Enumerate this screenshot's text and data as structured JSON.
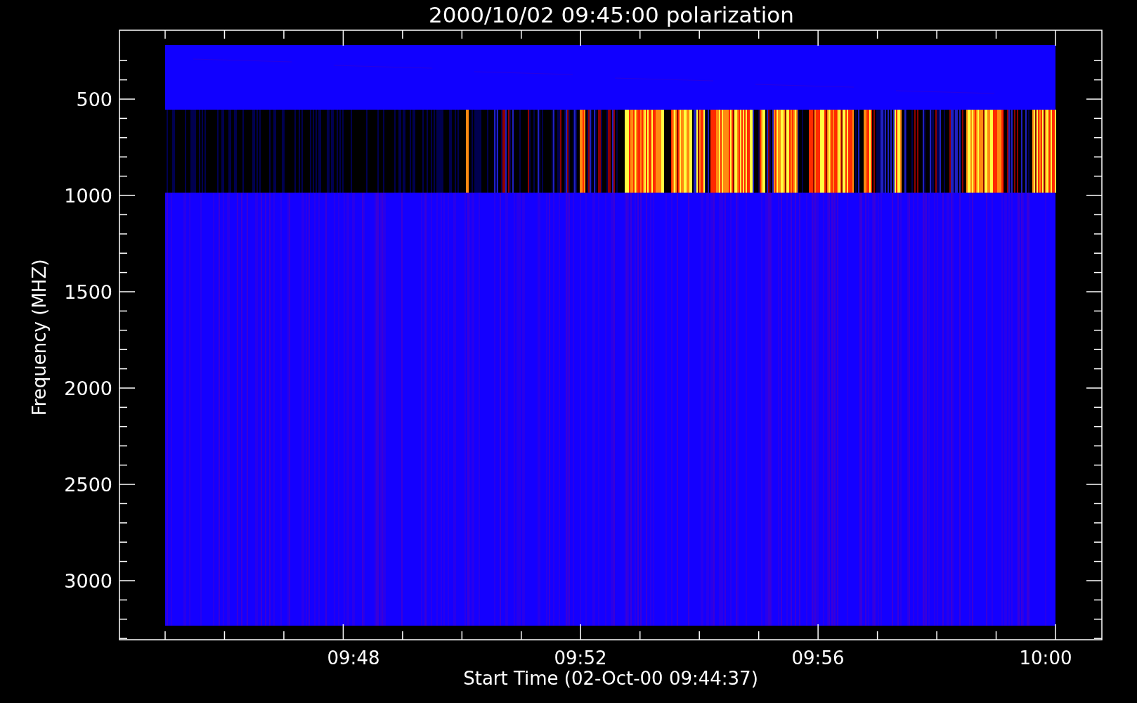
{
  "title": "2000/10/02 09:45:00 polarization",
  "y_axis": {
    "label": "Frequency (MHZ)",
    "ticks": [
      "500",
      "1000",
      "1500",
      "2000",
      "2500",
      "3000"
    ]
  },
  "x_axis": {
    "label": "Start Time (02-Oct-00 09:44:37)",
    "ticks": [
      "09:48",
      "09:52",
      "09:56",
      "10:00"
    ]
  }
}
